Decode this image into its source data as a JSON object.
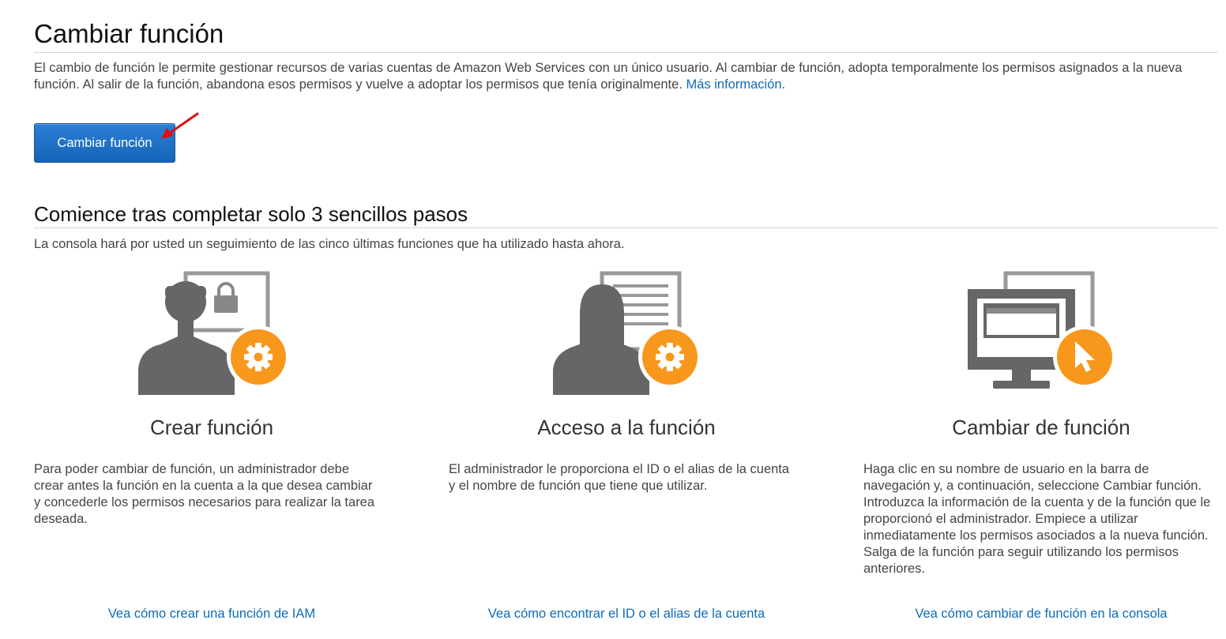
{
  "page": {
    "title": "Cambiar función",
    "intro_text": "El cambio de función le permite gestionar recursos de varias cuentas de Amazon Web Services con un único usuario. Al cambiar de función, adopta temporalmente los permisos asignados a la nueva función. Al salir de la función, abandona esos permisos y vuelve a adoptar los permisos que tenía originalmente.",
    "intro_link": "Más información.",
    "primary_button": "Cambiar función"
  },
  "steps_section": {
    "heading": "Comience tras completar solo 3 sencillos pasos",
    "subtext": "La consola hará por usted un seguimiento de las cinco últimas funciones que ha utilizado hasta ahora.",
    "steps": [
      {
        "icon": "admin-lock-gear-icon",
        "title": "Crear función",
        "description": "Para poder cambiar de función, un administrador debe crear antes la función en la cuenta a la que desea cambiar y concederle los permisos necesarios para realizar la tarea deseada.",
        "link": "Vea cómo crear una función de IAM"
      },
      {
        "icon": "user-document-gear-icon",
        "title": "Acceso a la función",
        "description": "El administrador le proporciona el ID o el alias de la cuenta y el nombre de función que tiene que utilizar.",
        "link": "Vea cómo encontrar el ID o el alias de la cuenta"
      },
      {
        "icon": "monitor-cursor-icon",
        "title": "Cambiar de función",
        "description": "Haga clic en su nombre de usuario en la barra de navegación y, a continuación, seleccione Cambiar función. Introduzca la información de la cuenta y de la función que le proporcionó el administrador. Empiece a utilizar inmediatamente los permisos asociados a la nueva función. Salga de la función para seguir utilizando los permisos anteriores.",
        "link": "Vea cómo cambiar de función en la consola"
      }
    ]
  },
  "colors": {
    "link": "#0d6bb7",
    "button": "#1f73c8",
    "icon_gray": "#666666",
    "icon_orange": "#f7981c",
    "annotation_arrow": "#e01010"
  }
}
